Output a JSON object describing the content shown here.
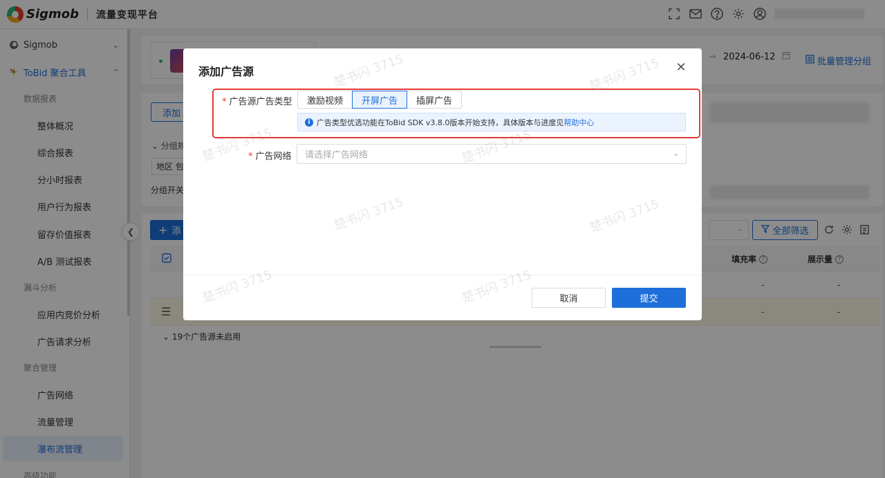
{
  "header": {
    "brand": "Sigmob",
    "platform": "流量变现平台",
    "icons": [
      "fullscreen-icon",
      "mail-icon",
      "help-icon",
      "settings-icon",
      "user-icon"
    ]
  },
  "sidebar": {
    "sigmob": "Sigmob",
    "tobid": "ToBid 聚合工具",
    "group_reports": "数据报表",
    "reports": [
      "整体概况",
      "综合报表",
      "分小时报表",
      "用户行为报表",
      "留存价值报表",
      "A/B 测试报表"
    ],
    "group_funnel": "漏斗分析",
    "funnel": [
      "应用内竞价分析",
      "广告请求分析"
    ],
    "group_agg": "聚合管理",
    "agg": [
      "广告网络",
      "流量管理",
      "瀑布流管理"
    ],
    "group_adv": "高级功能"
  },
  "background": {
    "date": "2024-06-12",
    "batch_manage": "批量管理分组",
    "add_btn": "添加",
    "group_rule": "分组规",
    "region_pkg": "地区  包",
    "group_switch": "分组开关",
    "add_source_btn": "添",
    "filter_all": "全部筛选",
    "col_fill_rate": "填充率",
    "col_impressions": "展示量",
    "dash": "-",
    "disabled_sources": "19个广告源未启用"
  },
  "modal": {
    "title": "添加广告源",
    "ad_type_label": "广告源广告类型",
    "ad_types": [
      "激励视频",
      "开屏广告",
      "插屏广告"
    ],
    "active_ad_type": "开屏广告",
    "notice_text": "广告类型优选功能在ToBid SDK v3.8.0版本开始支持，具体版本与进度见",
    "notice_link": "帮助中心",
    "network_label": "广告网络",
    "network_placeholder": "请选择广告网络",
    "cancel": "取消",
    "submit": "提交"
  },
  "watermark": "楚书闪 3715"
}
